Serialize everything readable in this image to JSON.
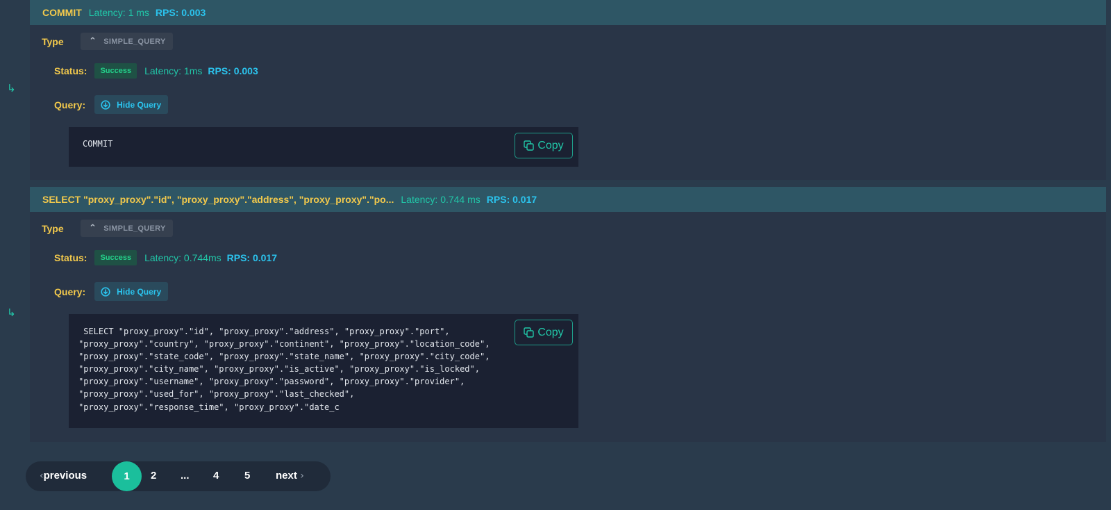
{
  "entries": [
    {
      "header": {
        "query": "COMMIT",
        "latency": "Latency: 1 ms",
        "rps": "RPS: 0.003"
      },
      "type_label": "Type",
      "type_value": "SIMPLE_QUERY",
      "status_label": "Status:",
      "status": "Success",
      "latency": "Latency: 1ms",
      "rps": "RPS: 0.003",
      "query_label": "Query:",
      "hide_query": "Hide Query",
      "code": "COMMIT",
      "copy": "Copy"
    },
    {
      "header": {
        "query": "SELECT \"proxy_proxy\".\"id\", \"proxy_proxy\".\"address\", \"proxy_proxy\".\"po...",
        "latency": "Latency: 0.744 ms",
        "rps": "RPS: 0.017"
      },
      "type_label": "Type",
      "type_value": "SIMPLE_QUERY",
      "status_label": "Status:",
      "status": "Success",
      "latency": "Latency: 0.744ms",
      "rps": "RPS: 0.017",
      "query_label": "Query:",
      "hide_query": "Hide Query",
      "code": " SELECT \"proxy_proxy\".\"id\", \"proxy_proxy\".\"address\", \"proxy_proxy\".\"port\",\n\"proxy_proxy\".\"country\", \"proxy_proxy\".\"continent\", \"proxy_proxy\".\"location_code\",\n\"proxy_proxy\".\"state_code\", \"proxy_proxy\".\"state_name\", \"proxy_proxy\".\"city_code\",\n\"proxy_proxy\".\"city_name\", \"proxy_proxy\".\"is_active\", \"proxy_proxy\".\"is_locked\",\n\"proxy_proxy\".\"username\", \"proxy_proxy\".\"password\", \"proxy_proxy\".\"provider\",\n\"proxy_proxy\".\"used_for\", \"proxy_proxy\".\"last_checked\",\n\"proxy_proxy\".\"response_time\", \"proxy_proxy\".\"date_c",
      "copy": "Copy"
    }
  ],
  "pagination": {
    "previous": "previous",
    "pages": [
      "1",
      "2",
      "...",
      "4",
      "5"
    ],
    "current": "1",
    "next": "next"
  },
  "icons": {
    "row_arrow": "return-arrow-icon",
    "type_toggle": "chevron-up-icon",
    "hide_query": "circle-arrow-icon",
    "copy": "copy-icon"
  },
  "colors": {
    "accent": "#1bbf9c",
    "label": "#f2c94c",
    "latency": "#21c7a8",
    "rps": "#2bc4ee"
  }
}
